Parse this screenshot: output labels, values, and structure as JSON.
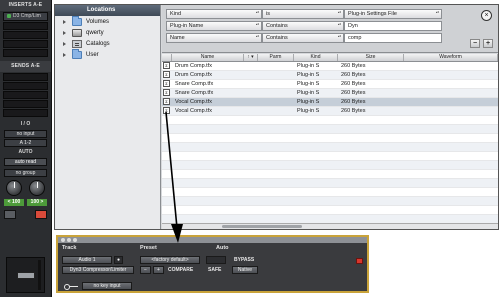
{
  "mixer_strip": {
    "inserts_header": "INSERTS A-E",
    "inserts": [
      {
        "name": "D3 Cmp/Lim",
        "filled": true
      },
      {
        "name": "",
        "filled": false
      },
      {
        "name": "",
        "filled": false
      },
      {
        "name": "",
        "filled": false
      },
      {
        "name": "",
        "filled": false
      }
    ],
    "sends_header": "SENDS A-E",
    "io_header": "I / O",
    "input": "no input",
    "output": "A 1-2",
    "auto_header": "AUTO",
    "auto_mode": "auto read",
    "group": "no group",
    "pan_left": "< 100",
    "pan_right": "100 >"
  },
  "browser": {
    "locations_title": "Locations",
    "locations": [
      {
        "label": "Volumes",
        "icon": "folder-icon"
      },
      {
        "label": "qwerty",
        "icon": "drive-icon"
      },
      {
        "label": "Catalogs",
        "icon": "catalog-icon"
      },
      {
        "label": "User",
        "icon": "folder-icon"
      }
    ],
    "search_rows": [
      {
        "field": "Kind",
        "op": "is",
        "value": "Plug-in Settings File",
        "value_is_select": true
      },
      {
        "field": "Plug-in Name",
        "op": "Contains",
        "value": "Dyn",
        "value_is_select": false
      },
      {
        "field": "Name",
        "op": "Contains",
        "value": "comp",
        "value_is_select": false
      }
    ],
    "columns": [
      "Name",
      "↑ ▾",
      "Parm",
      "Kind",
      "Size",
      "Waveform"
    ],
    "rows": [
      {
        "name": "Drum Comp.tfx",
        "kind": "Plug-in S",
        "size": "260 Bytes"
      },
      {
        "name": "Drum Comp.tfx",
        "kind": "Plug-in S",
        "size": "260 Bytes"
      },
      {
        "name": "Snare Comp.tfx",
        "kind": "Plug-in S",
        "size": "260 Bytes"
      },
      {
        "name": "Snare Comp.tfx",
        "kind": "Plug-in S",
        "size": "260 Bytes"
      },
      {
        "name": "Vocal Comp.tfx",
        "kind": "Plug-in S",
        "size": "260 Bytes",
        "selected": true
      },
      {
        "name": "Vocal Comp.tfx",
        "kind": "Plug-in S",
        "size": "260 Bytes"
      }
    ],
    "empty_rows": 12
  },
  "plugin": {
    "track_label": "Track",
    "preset_label": "Preset",
    "auto_label": "Auto",
    "track_name": "Audio 1",
    "insert_name": "Dyn3 Compressor/Limiter",
    "preset_name": "<factory default>",
    "compare_label": "COMPARE",
    "safe_label": "SAFE",
    "bypass_label": "BYPASS",
    "native_label": "Native",
    "key_input": "no key input",
    "minus_label": "−",
    "plus_label": "+"
  },
  "colors": {
    "plugin_border": "#c9a33a",
    "pan_green": "#4d9a3a",
    "mute_red": "#d94a3a"
  }
}
